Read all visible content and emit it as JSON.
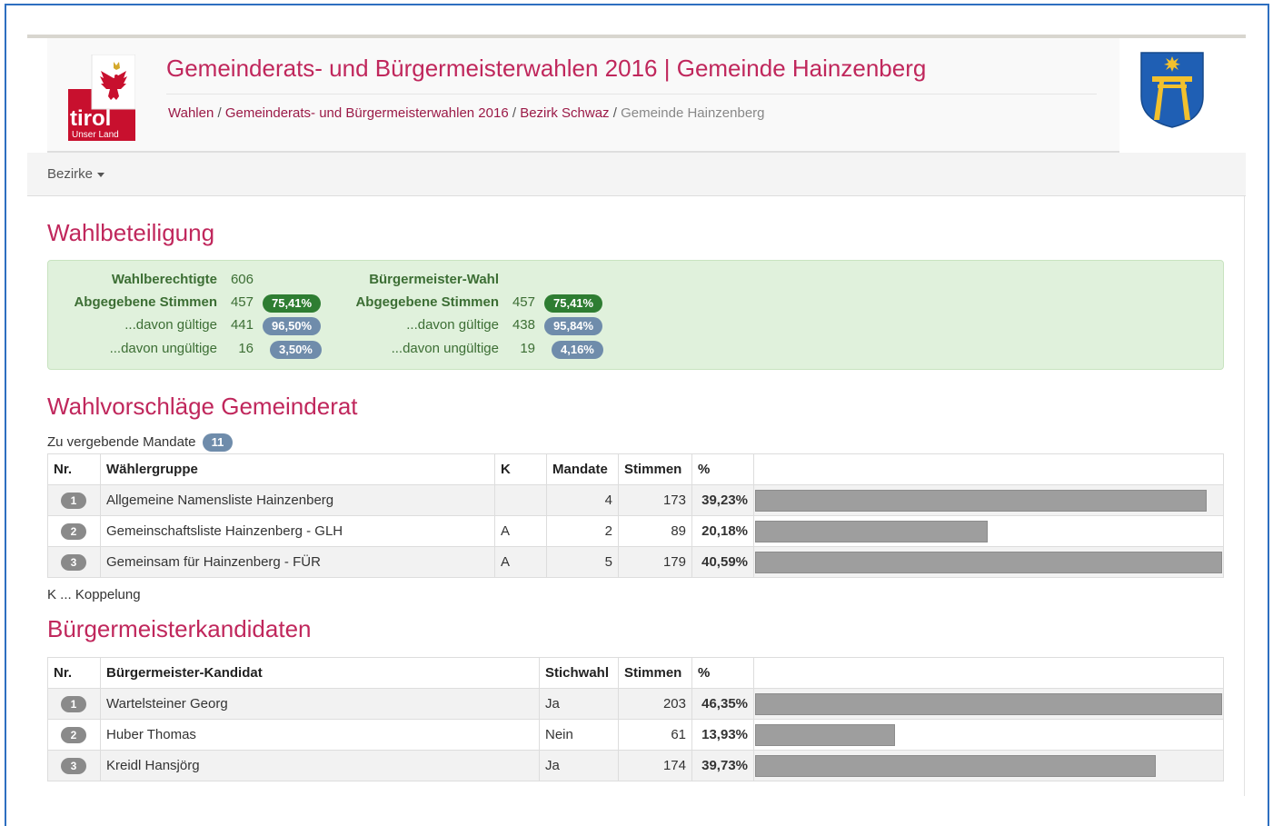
{
  "header": {
    "title": "Gemeinderats- und Bürgermeisterwahlen 2016 | Gemeinde Hainzenberg",
    "logo_text": "tirol",
    "logo_subtext": "Unser Land",
    "breadcrumb": [
      "Wahlen",
      "Gemeinderats- und Bürgermeisterwahlen 2016",
      "Bezirk Schwaz",
      "Gemeinde Hainzenberg"
    ],
    "separator": "/"
  },
  "colors": {
    "accent": "#c0275c",
    "badge_green": "#2e7d32",
    "badge_blue": "#6f8cab",
    "bar": "#9e9e9e",
    "panel_bg": "#e0f1dc"
  },
  "nav": {
    "bezirke_label": "Bezirke"
  },
  "turnout": {
    "heading": "Wahlbeteiligung",
    "gemeinderat": {
      "wahlberechtigte_label": "Wahlberechtigte",
      "wahlberechtigte": "606",
      "abgegeben_label": "Abgegebene Stimmen",
      "abgegeben": "457",
      "abgegeben_pct": "75,41%",
      "gueltig_label": "...davon gültige",
      "gueltig": "441",
      "gueltig_pct": "96,50%",
      "ungueltig_label": "...davon ungültige",
      "ungueltig": "16",
      "ungueltig_pct": "3,50%"
    },
    "bgm": {
      "heading": "Bürgermeister-Wahl",
      "abgegeben_label": "Abgegebene Stimmen",
      "abgegeben": "457",
      "abgegeben_pct": "75,41%",
      "gueltig_label": "...davon gültige",
      "gueltig": "438",
      "gueltig_pct": "95,84%",
      "ungueltig_label": "...davon ungültige",
      "ungueltig": "19",
      "ungueltig_pct": "4,16%"
    }
  },
  "gemeinderat": {
    "heading": "Wahlvorschläge Gemeinderat",
    "mandate_label": "Zu vergebende Mandate",
    "mandate_count": "11",
    "columns": {
      "nr": "Nr.",
      "group": "Wählergruppe",
      "k": "K",
      "mandate": "Mandate",
      "stimmen": "Stimmen",
      "pct": "%"
    },
    "rows": [
      {
        "nr": "1",
        "name": "Allgemeine Namensliste Hainzenberg",
        "k": "",
        "mandate": "4",
        "stimmen": "173",
        "pct": "39,23%",
        "share": 0.3923
      },
      {
        "nr": "2",
        "name": "Gemeinschaftsliste Hainzenberg - GLH",
        "k": "A",
        "mandate": "2",
        "stimmen": "89",
        "pct": "20,18%",
        "share": 0.2018
      },
      {
        "nr": "3",
        "name": "Gemeinsam für Hainzenberg - FÜR",
        "k": "A",
        "mandate": "5",
        "stimmen": "179",
        "pct": "40,59%",
        "share": 0.4059
      }
    ],
    "legend": "K ... Koppelung"
  },
  "buergermeister": {
    "heading": "Bürgermeisterkandidaten",
    "columns": {
      "nr": "Nr.",
      "name": "Bürgermeister-Kandidat",
      "stichwahl": "Stichwahl",
      "stimmen": "Stimmen",
      "pct": "%"
    },
    "rows": [
      {
        "nr": "1",
        "name": "Wartelsteiner Georg",
        "stichwahl": "Ja",
        "stimmen": "203",
        "pct": "46,35%",
        "share": 0.4635
      },
      {
        "nr": "2",
        "name": "Huber Thomas",
        "stichwahl": "Nein",
        "stimmen": "61",
        "pct": "13,93%",
        "share": 0.1393
      },
      {
        "nr": "3",
        "name": "Kreidl Hansjörg",
        "stichwahl": "Ja",
        "stimmen": "174",
        "pct": "39,73%",
        "share": 0.3973
      }
    ]
  }
}
